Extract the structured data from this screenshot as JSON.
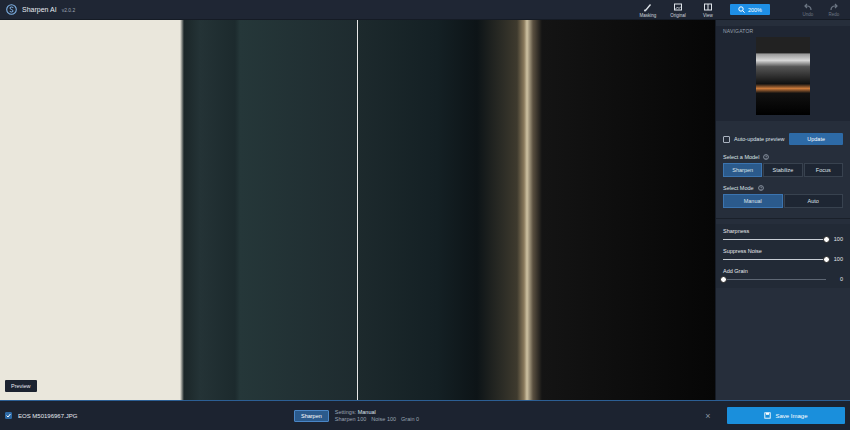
{
  "app": {
    "name": "Sharpen AI",
    "version": "v2.0.2"
  },
  "toolbar": [
    {
      "label": "Masking"
    },
    {
      "label": "Original"
    },
    {
      "label": "View"
    }
  ],
  "zoom": {
    "label": "200%"
  },
  "history": [
    {
      "label": "Undo",
      "disabled": true
    },
    {
      "label": "Redo",
      "disabled": true
    }
  ],
  "preview": {
    "label": "Preview"
  },
  "navigator": {
    "title": "NAVIGATOR"
  },
  "auto_update": {
    "label": "Auto-update preview",
    "checked": false
  },
  "update_button": "Update",
  "model": {
    "label": "Select a Model",
    "options": [
      {
        "label": "Sharpen",
        "selected": true
      },
      {
        "label": "Stabilize",
        "selected": false
      },
      {
        "label": "Focus",
        "selected": false
      }
    ]
  },
  "mode": {
    "label": "Select Mode",
    "options": [
      {
        "label": "Manual",
        "selected": true
      },
      {
        "label": "Auto",
        "selected": false
      }
    ]
  },
  "sliders": [
    {
      "label": "Sharpness",
      "reading": "100",
      "level": 1
    },
    {
      "label": "Suppress Noise",
      "reading": "100",
      "level": 1
    },
    {
      "label": "Add Grain",
      "reading": "0",
      "level": 0
    }
  ],
  "file": {
    "name": "EOS M50196967.JPG",
    "checked": true,
    "model": "Sharpen",
    "settings_label": "Settings:",
    "settings_value": "Manual",
    "params": [
      "Sharpen 100",
      "Noise 100",
      "Grain 0"
    ]
  },
  "close": "×",
  "save_button": "Save Image"
}
